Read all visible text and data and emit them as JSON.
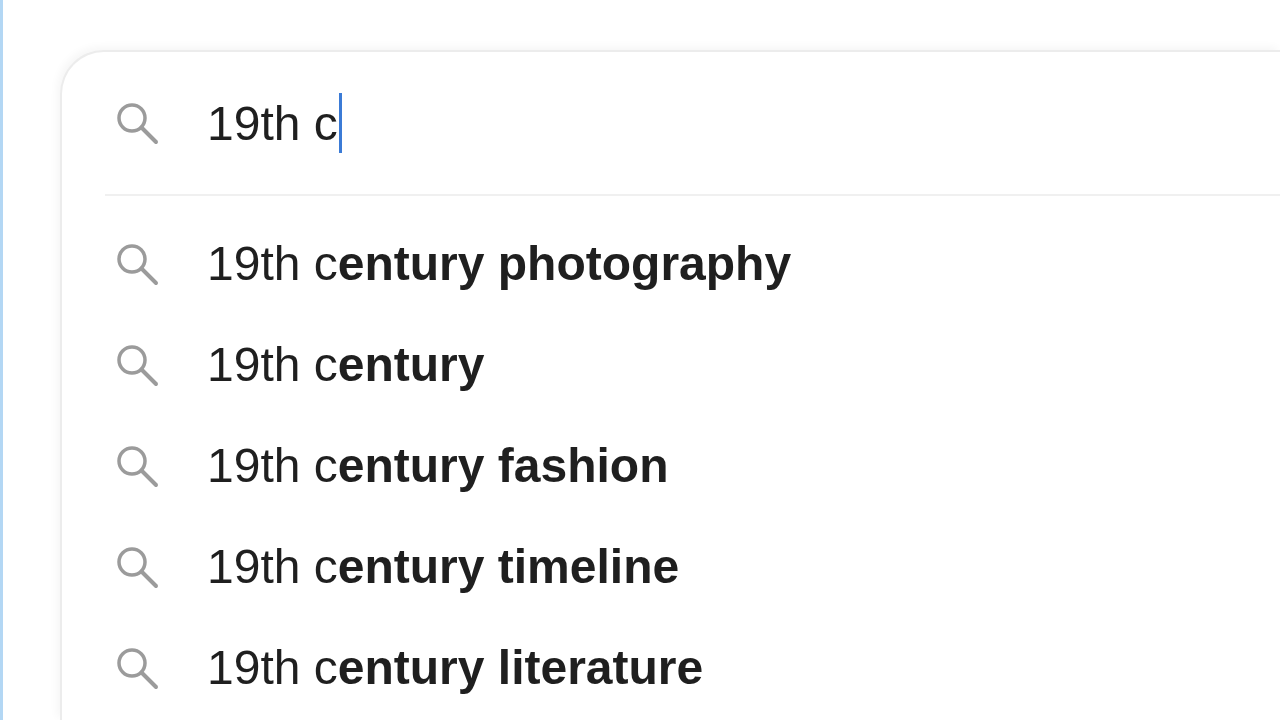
{
  "search": {
    "value": "19th c",
    "focused": true
  },
  "suggestions": [
    {
      "text": "19th c**entury photography**",
      "selected": false
    },
    {
      "text": "19th c**entury**",
      "selected": false
    },
    {
      "text": "19th c**entury fashion**",
      "selected": false
    },
    {
      "text": "19th c**entury timeline**",
      "selected": false
    },
    {
      "text": "19th c**entury literature**",
      "selected": false
    }
  ]
}
